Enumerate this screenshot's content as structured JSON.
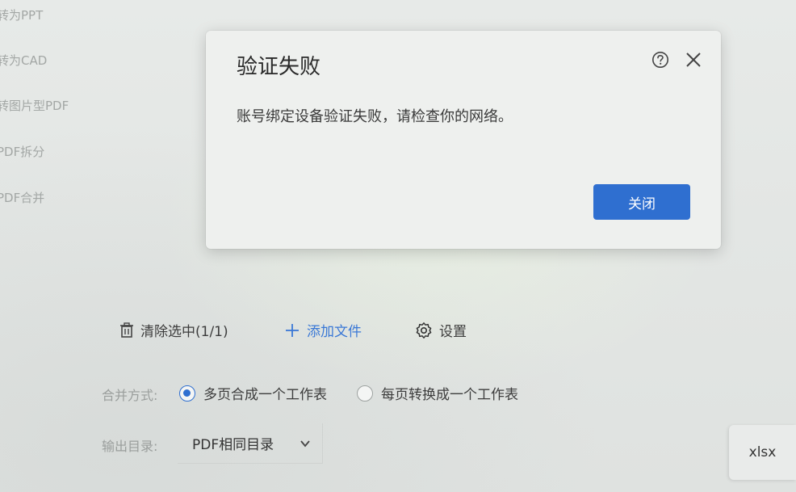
{
  "sidebar": {
    "items": [
      {
        "label": "转为PPT"
      },
      {
        "label": "转为CAD"
      },
      {
        "label": "转图片型PDF"
      },
      {
        "label": "PDF拆分"
      },
      {
        "label": "PDF合并"
      }
    ]
  },
  "dialog": {
    "title": "验证失败",
    "message": "账号绑定设备验证失败，请检查你的网络。",
    "close_button": "关闭",
    "help_icon": "help-circle-icon",
    "close_icon": "close-icon"
  },
  "toolbar": {
    "clear_label": "清除选中(1/1)",
    "add_label": "添加文件",
    "settings_label": "设置"
  },
  "merge_mode": {
    "label": "合并方式:",
    "options": [
      {
        "label": "多页合成一个工作表",
        "checked": true
      },
      {
        "label": "每页转换成一个工作表",
        "checked": false
      }
    ]
  },
  "output": {
    "label": "输出目录:",
    "selected": "PDF相同目录"
  },
  "format": {
    "label": "xlsx"
  },
  "colors": {
    "accent": "#2f6fd0",
    "link": "#3a78d6"
  }
}
